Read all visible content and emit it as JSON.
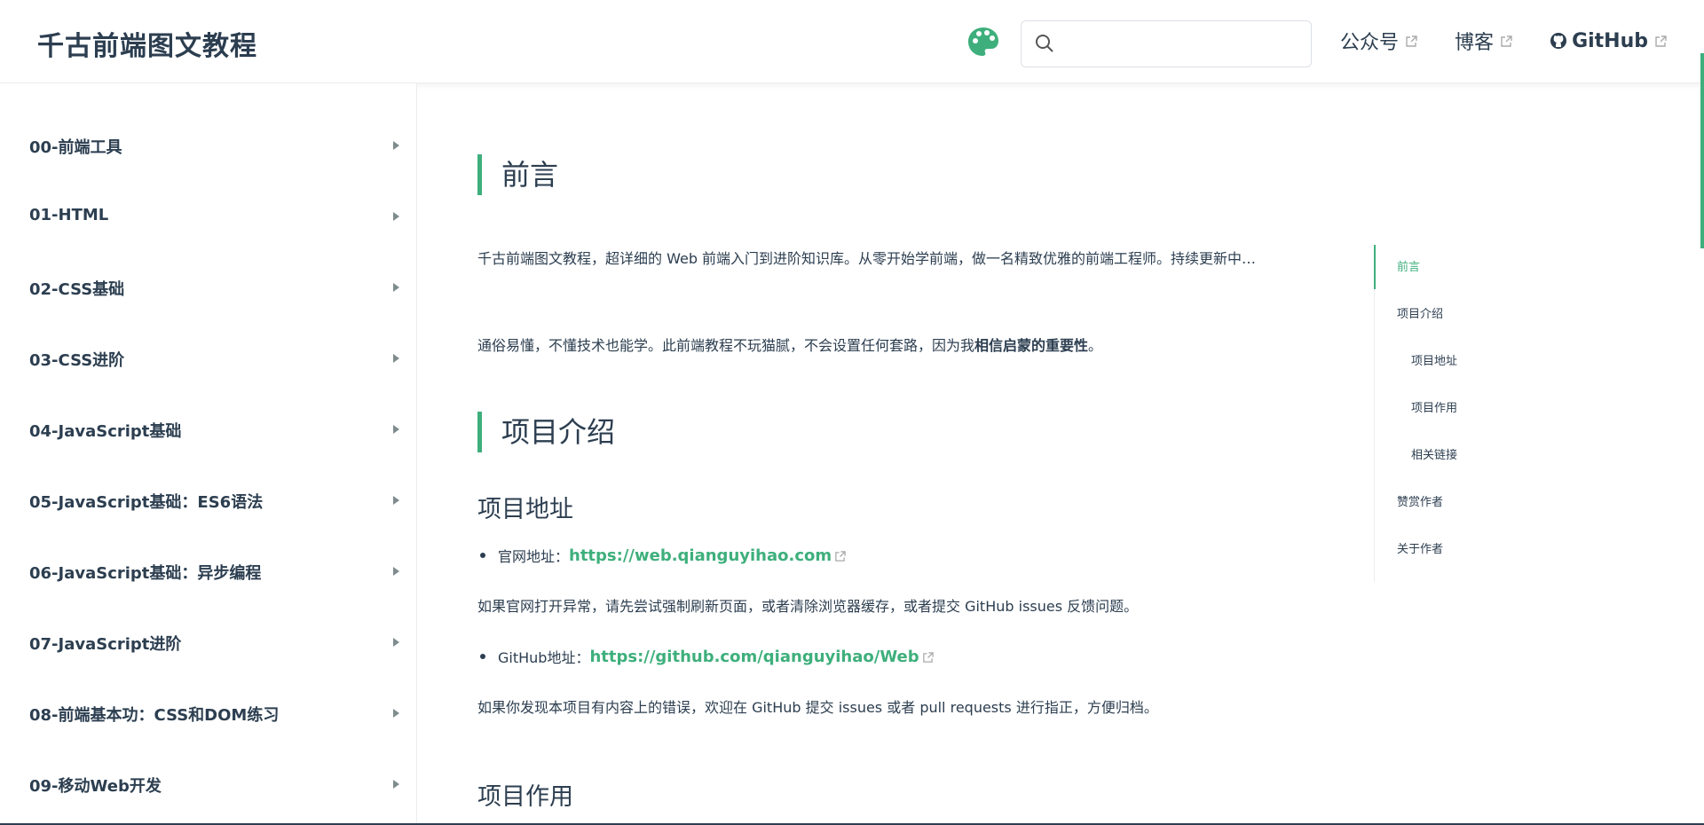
{
  "header": {
    "site_title": "千古前端图文教程",
    "search_placeholder": "",
    "nav": [
      {
        "label": "公众号"
      },
      {
        "label": "博客"
      },
      {
        "label": "GitHub"
      }
    ],
    "accent_color": "#3eaf7c"
  },
  "sidebar": {
    "items": [
      {
        "label": "00-前端工具"
      },
      {
        "label": "01-HTML"
      },
      {
        "label": "02-CSS基础"
      },
      {
        "label": "03-CSS进阶"
      },
      {
        "label": "04-JavaScript基础"
      },
      {
        "label": "05-JavaScript基础：ES6语法"
      },
      {
        "label": "06-JavaScript基础：异步编程"
      },
      {
        "label": "07-JavaScript进阶"
      },
      {
        "label": "08-前端基本功：CSS和DOM练习"
      },
      {
        "label": "09-移动Web开发"
      }
    ]
  },
  "content": {
    "h_preface": "前言",
    "intro_text": "千古前端图文教程，超详细的 Web 前端入门到进阶知识库。从零开始学前端，做一名精致优雅的前端工程师。持续更新中…",
    "note_prefix": "通俗易懂，不懂技术也能学。此前端教程不玩猫腻，不会设置任何套路，因为我",
    "note_bold": "相信启蒙的重要性",
    "note_suffix": "。",
    "h_project_intro": "项目介绍",
    "h_project_address": "项目地址",
    "site_label": "官网地址：",
    "site_url": "https://web.qianguyihao.com",
    "site_note": "如果官网打开异常，请先尝试强制刷新页面，或者清除浏览器缓存，或者提交 GitHub issues 反馈问题。",
    "github_label": "GitHub地址：",
    "github_url": "https://github.com/qianguyihao/Web",
    "github_note": "如果你发现本项目有内容上的错误，欢迎在 GitHub 提交 issues 或者 pull requests 进行指正，方便归档。",
    "h_project_use": "项目作用"
  },
  "toc": {
    "items": [
      {
        "label": "前言"
      },
      {
        "label": "项目介绍"
      },
      {
        "label": "项目地址"
      },
      {
        "label": "项目作用"
      },
      {
        "label": "相关链接"
      },
      {
        "label": "赞赏作者"
      },
      {
        "label": "关于作者"
      }
    ]
  }
}
